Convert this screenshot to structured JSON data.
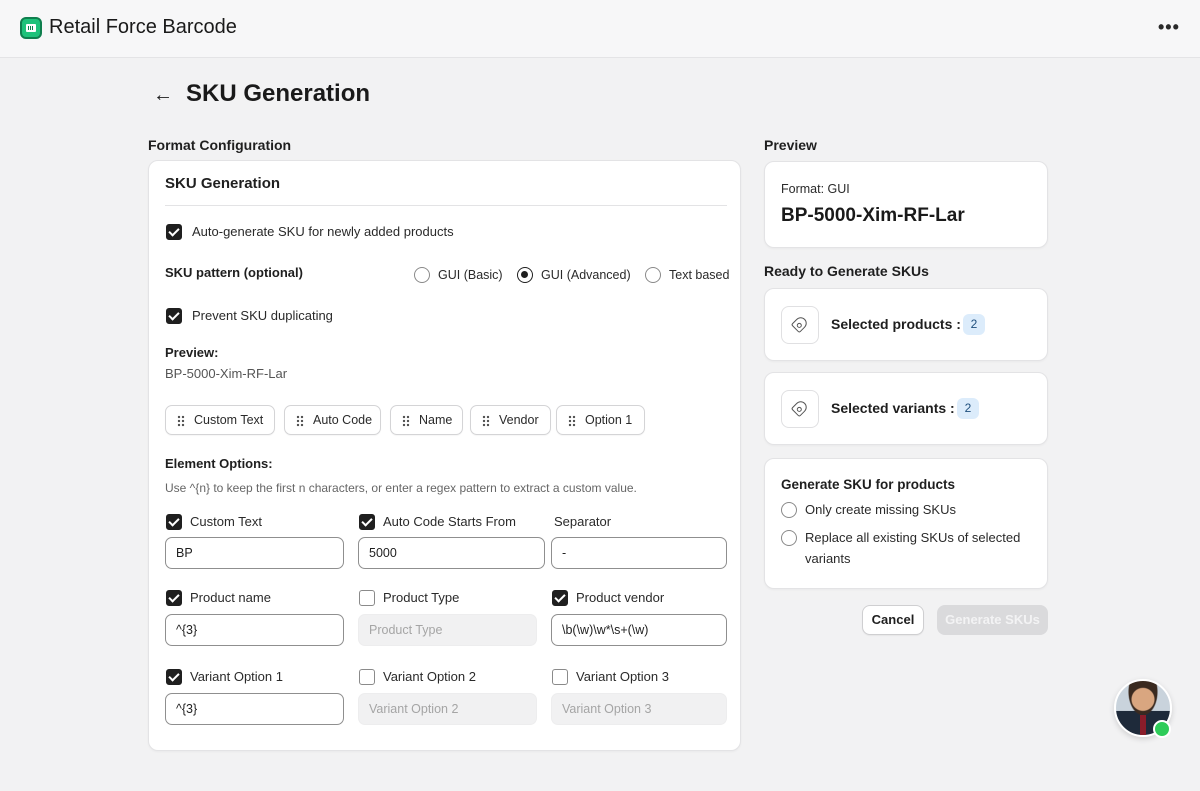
{
  "app": {
    "title": "Retail Force Barcode"
  },
  "page": {
    "title": "SKU Generation"
  },
  "format_config": {
    "section_label": "Format Configuration",
    "card_title": "SKU Generation",
    "auto_generate_label": "Auto-generate SKU for newly added products",
    "auto_generate_checked": true,
    "pattern_label": "SKU pattern (optional)",
    "pattern_options": [
      "GUI (Basic)",
      "GUI (Advanced)",
      "Text based"
    ],
    "pattern_selected": "GUI (Advanced)",
    "prevent_dup_label": "Prevent SKU duplicating",
    "prevent_dup_checked": true,
    "preview_label": "Preview:",
    "preview_value": "BP-5000-Xim-RF-Lar",
    "chips": [
      "Custom Text",
      "Auto Code",
      "Name",
      "Vendor",
      "Option 1"
    ],
    "element_options_label": "Element Options:",
    "element_options_hint": "Use ^{n} to keep the first n characters, or enter a regex pattern to extract a custom value.",
    "fields": {
      "custom_text": {
        "label": "Custom Text",
        "checked": true,
        "value": "BP"
      },
      "auto_code": {
        "label": "Auto Code Starts From",
        "checked": true,
        "value": "5000"
      },
      "separator": {
        "label": "Separator",
        "value": "-"
      },
      "product_name": {
        "label": "Product name",
        "checked": true,
        "value": "^{3}"
      },
      "product_type": {
        "label": "Product Type",
        "checked": false,
        "placeholder": "Product Type"
      },
      "product_vendor": {
        "label": "Product vendor",
        "checked": true,
        "value": "\\b(\\w)\\w*\\s+(\\w)"
      },
      "variant_option_1": {
        "label": "Variant Option 1",
        "checked": true,
        "value": "^{3}"
      },
      "variant_option_2": {
        "label": "Variant Option 2",
        "checked": false,
        "placeholder": "Variant Option 2"
      },
      "variant_option_3": {
        "label": "Variant Option 3",
        "checked": false,
        "placeholder": "Variant Option 3"
      }
    }
  },
  "preview": {
    "section_label": "Preview",
    "format_text": "Format: GUI",
    "value": "BP-5000-Xim-RF-Lar"
  },
  "ready": {
    "section_label": "Ready to Generate SKUs",
    "selected_products_label": "Selected products :",
    "selected_products_count": "2",
    "selected_variants_label": "Selected variants :",
    "selected_variants_count": "2"
  },
  "generate_for": {
    "title": "Generate SKU for products",
    "options": [
      "Only create missing SKUs",
      "Replace all existing SKUs of selected",
      "variants"
    ]
  },
  "actions": {
    "cancel_label": "Cancel",
    "generate_label": "Generate SKUs"
  },
  "colors": {
    "accent": "#1ec27a",
    "badge_bg": "#dcecfb",
    "online": "#2ecc59"
  }
}
